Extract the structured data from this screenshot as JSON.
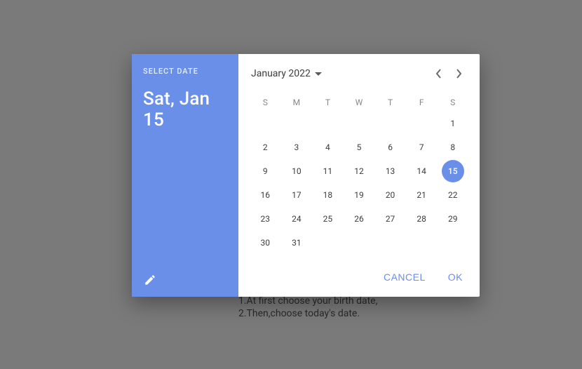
{
  "backdrop": {
    "line1": "1.At first choose your birth date,",
    "line2": "2.Then,choose today's date."
  },
  "side": {
    "label": "SELECT DATE",
    "date": "Sat, Jan 15"
  },
  "header": {
    "month_label": "January 2022"
  },
  "dow": [
    "S",
    "M",
    "T",
    "W",
    "T",
    "F",
    "S"
  ],
  "calendar": {
    "leading_blanks": 6,
    "days_in_month": 31,
    "selected_day": 15
  },
  "actions": {
    "cancel": "CANCEL",
    "ok": "OK"
  }
}
